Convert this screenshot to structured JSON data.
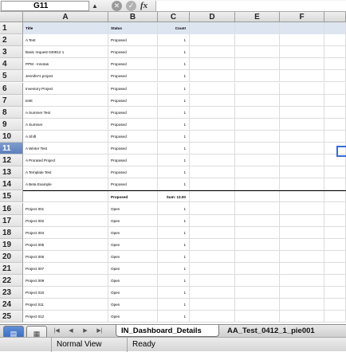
{
  "formula_bar": {
    "name_box": "G11",
    "fx": "fx",
    "cancel_glyph": "✕",
    "confirm_glyph": "✓"
  },
  "columns": [
    "A",
    "B",
    "C",
    "D",
    "E",
    "F"
  ],
  "rows": [
    {
      "num": "1",
      "a": "Title",
      "b": "Status",
      "c": "Count",
      "header": true
    },
    {
      "num": "2",
      "a": "A Test",
      "b": "Proposed",
      "c": "1"
    },
    {
      "num": "3",
      "a": "Basic request 040912 1",
      "b": "Proposed",
      "c": "1"
    },
    {
      "num": "4",
      "a": "PPM - Innotas",
      "b": "Proposed",
      "c": "1"
    },
    {
      "num": "5",
      "a": "Jennifer's project",
      "b": "Proposed",
      "c": "1"
    },
    {
      "num": "6",
      "a": "Inventory Project",
      "b": "Proposed",
      "c": "1"
    },
    {
      "num": "7",
      "a": "testt",
      "b": "Proposed",
      "c": "1"
    },
    {
      "num": "8",
      "a": "A Summer Test",
      "b": "Proposed",
      "c": "1"
    },
    {
      "num": "9",
      "a": "A Summer",
      "b": "Proposed",
      "c": "1"
    },
    {
      "num": "10",
      "a": "A Shift",
      "b": "Proposed",
      "c": "1"
    },
    {
      "num": "11",
      "a": "A Winter Test",
      "b": "Proposed",
      "c": "1",
      "selected": true
    },
    {
      "num": "12",
      "a": "A Prorated Project",
      "b": "Proposed",
      "c": "1"
    },
    {
      "num": "13",
      "a": "A Template Test",
      "b": "Proposed",
      "c": "1"
    },
    {
      "num": "14",
      "a": "A Beta Example",
      "b": "Proposed",
      "c": "1"
    },
    {
      "num": "15",
      "a": "",
      "b": "Proposed",
      "c": "Sum: 13.00",
      "total": true
    },
    {
      "num": "16",
      "a": "Project 001",
      "b": "Open",
      "c": "1"
    },
    {
      "num": "17",
      "a": "Project 002",
      "b": "Open",
      "c": "1"
    },
    {
      "num": "18",
      "a": "Project 004",
      "b": "Open",
      "c": "1"
    },
    {
      "num": "19",
      "a": "Project 005",
      "b": "Open",
      "c": "1"
    },
    {
      "num": "20",
      "a": "Project 006",
      "b": "Open",
      "c": "1"
    },
    {
      "num": "21",
      "a": "Project 007",
      "b": "Open",
      "c": "1"
    },
    {
      "num": "22",
      "a": "Project 009",
      "b": "Open",
      "c": "1"
    },
    {
      "num": "23",
      "a": "Project 010",
      "b": "Open",
      "c": "1"
    },
    {
      "num": "24",
      "a": "Project 011",
      "b": "Open",
      "c": "1"
    },
    {
      "num": "25",
      "a": "Project 012",
      "b": "Open",
      "c": "1"
    }
  ],
  "sheet_tabs": {
    "nav": [
      "|◀",
      "◀",
      "▶",
      "▶|"
    ],
    "active": "IN_Dashboard_Details",
    "other": "AA_Test_0412_1_pie001"
  },
  "view_buttons": [
    "▤",
    "▦"
  ],
  "status": {
    "view": "Normal View",
    "state": "Ready"
  }
}
